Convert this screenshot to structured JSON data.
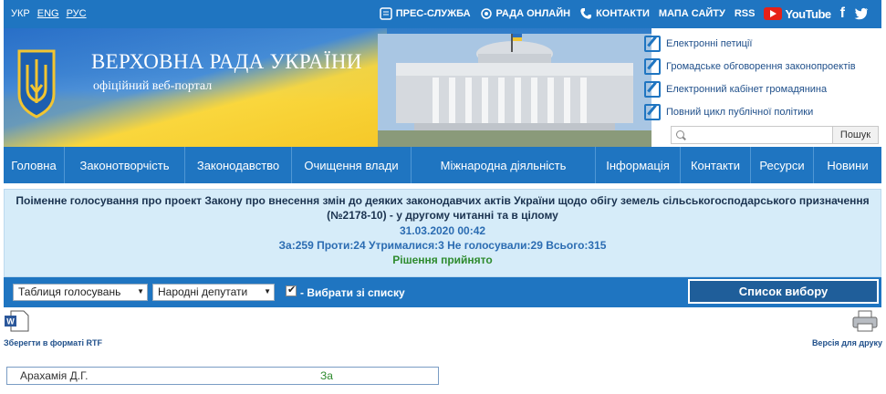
{
  "topbar": {
    "langs": [
      "УКР",
      "ENG",
      "РУС"
    ],
    "press": "ПРЕС-СЛУЖБА",
    "online": "РАДА ОНЛАЙН",
    "contacts": "КОНТАКТИ",
    "sitemap": "МАПА САЙТУ",
    "rss": "RSS",
    "youtube": "YouTube",
    "facebook": "f"
  },
  "banner": {
    "title": "ВЕРХОВНА РАДА УКРАЇНИ",
    "subtitle": "офіційний веб-портал"
  },
  "sidelinks": [
    "Електронні петиції",
    "Громадське обговорення законопроектів",
    "Електронний кабінет громадянина",
    "Повний цикл публічної політики"
  ],
  "search": {
    "button": "Пошук",
    "placeholder": ""
  },
  "nav": [
    "Головна",
    "Законотворчість",
    "Законодавство",
    "Очищення влади",
    "Міжнародна діяльність",
    "Інформація",
    "Контакти",
    "Ресурси",
    "Новини"
  ],
  "result": {
    "question": "Поіменне голосування про проект Закону про внесення змін до деяких законодавчих актів України щодо обігу земель сільськогосподарського призначення (№2178-10) - у другому читанні та в цілому",
    "datetime": "31.03.2020 00:42",
    "totals": "За:259 Проти:24 Утрималися:3 Не голосували:29 Всього:315",
    "decision": "Рішення прийнято"
  },
  "filters": {
    "view": "Таблиця голосувань",
    "group": "Народні депутати",
    "checkbox_label": "- Вибрати зі списку",
    "list_button": "Список вибору"
  },
  "tools": {
    "rtf": "Зберегти в форматі RTF",
    "print": "Версія для друку"
  },
  "votes": [
    {
      "name": "Арахамія Д.Г.",
      "vote": "За"
    }
  ],
  "colors": {
    "primary": "#1f75c1",
    "result_bg": "#d6ecf9",
    "vote_green": "#2e8b2e"
  }
}
